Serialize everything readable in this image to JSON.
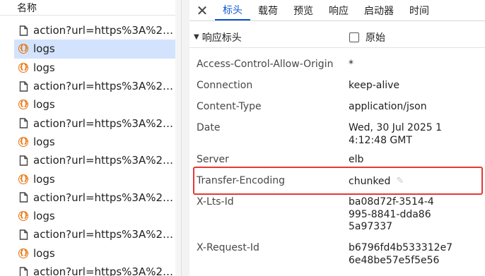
{
  "request_list": {
    "header": "名称",
    "items": [
      {
        "type": "document",
        "label": "action?url=https%3A%2F...",
        "selected": false
      },
      {
        "type": "script",
        "label": "logs",
        "selected": true
      },
      {
        "type": "script",
        "label": "logs",
        "selected": false
      },
      {
        "type": "document",
        "label": "action?url=https%3A%2F...",
        "selected": false
      },
      {
        "type": "script",
        "label": "logs",
        "selected": false
      },
      {
        "type": "document",
        "label": "action?url=https%3A%2F...",
        "selected": false
      },
      {
        "type": "script",
        "label": "logs",
        "selected": false
      },
      {
        "type": "document",
        "label": "action?url=https%3A%2F...",
        "selected": false
      },
      {
        "type": "script",
        "label": "logs",
        "selected": false
      },
      {
        "type": "document",
        "label": "action?url=https%3A%2F...",
        "selected": false
      },
      {
        "type": "script",
        "label": "logs",
        "selected": false
      },
      {
        "type": "document",
        "label": "action?url=https%3A%2F...",
        "selected": false
      },
      {
        "type": "script",
        "label": "logs",
        "selected": false
      },
      {
        "type": "document",
        "label": "action?url=https%3A%2F...",
        "selected": false
      }
    ]
  },
  "details": {
    "close_glyph": "✕",
    "tabs": [
      {
        "label": "标头",
        "active": true
      },
      {
        "label": "载荷",
        "active": false
      },
      {
        "label": "预览",
        "active": false
      },
      {
        "label": "响应",
        "active": false
      },
      {
        "label": "启动器",
        "active": false
      },
      {
        "label": "时间",
        "active": false
      }
    ],
    "section": {
      "toggle_glyph": "▼",
      "title": "响应标头",
      "raw_label": "原始",
      "raw_checked": false
    },
    "response_headers": [
      {
        "name": "Access-Control-Allow-Origin",
        "value": "*"
      },
      {
        "name": "Connection",
        "value": "keep-alive"
      },
      {
        "name": "Content-Type",
        "value": "application/json"
      },
      {
        "name": "Date",
        "value": "Wed, 30 Jul 2025 14:12:48 GMT"
      },
      {
        "name": "Server",
        "value": "elb"
      },
      {
        "name": "Transfer-Encoding",
        "value": "chunked",
        "highlighted": true
      },
      {
        "name": "X-Lts-Id",
        "value": "ba08d72f-3514-4995-8841-dda865a97337"
      },
      {
        "name": "X-Request-Id",
        "value": "b6796fd4b533312e76e48be57e5f5e56"
      }
    ]
  },
  "colors": {
    "accent": "#0b57d0",
    "selected_row": "#d3e3fd",
    "script_icon": "#e8710a",
    "highlight_border": "#e53935"
  }
}
